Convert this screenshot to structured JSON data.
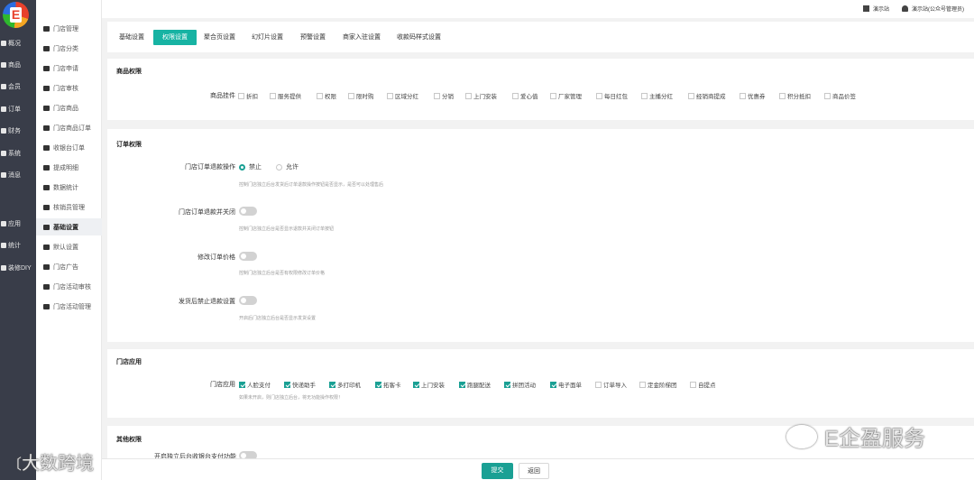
{
  "rail": {
    "logo_letter": "E",
    "items": [
      "概况",
      "商品",
      "会员",
      "订单",
      "财务",
      "系统",
      "消息",
      "应用",
      "统计",
      "装修DIY"
    ]
  },
  "submenu": {
    "items": [
      "门店管理",
      "门店分类",
      "门店申请",
      "门店审核",
      "门店商品",
      "门店商品订单",
      "收银台订单",
      "提成明细",
      "数据统计",
      "核销员管理",
      "基础设置",
      "默认设置",
      "门店广告",
      "门店活动审核",
      "门店活动管理"
    ]
  },
  "topbar": {
    "site": "演示站",
    "user": "演示站(公众号管理员)"
  },
  "tabs": [
    "基础设置",
    "权限设置",
    "聚合页设置",
    "幻灯片设置",
    "预警设置",
    "商家入驻设置",
    "收款码样式设置"
  ],
  "goods_perm": {
    "title": "商品权限",
    "label": "商品挂件",
    "options": [
      "折扣",
      "服务提供",
      "权限",
      "限时购",
      "区域分红",
      "分销",
      "上门安装",
      "爱心值",
      "厂家管理",
      "每日红包",
      "主播分红",
      "经销商提成",
      "优惠券",
      "积分抵扣",
      "商品价签"
    ]
  },
  "order_perm": {
    "title": "订单权限",
    "refund_label": "门店订单退款操作",
    "radio_forbid": "禁止",
    "radio_allow": "允许",
    "refund_hint": "控制门店独立后台发货后订单退款操作按钮是否显示，是否可以处理售后",
    "close_label": "门店订单退款并关闭",
    "close_hint": "控制门店独立后台是否显示退款并关闭订单按钮",
    "price_label": "修改订单价格",
    "price_hint": "控制门店独立后台是否有权限修改订单价格",
    "ship_label": "发货后禁止退款设置",
    "ship_hint": "开启后门店独立后台是否显示发货设置"
  },
  "store_apps": {
    "title": "门店应用",
    "label": "门店应用",
    "options": [
      {
        "label": "人脸支付",
        "on": true
      },
      {
        "label": "快递助手",
        "on": true
      },
      {
        "label": "多打印机",
        "on": true
      },
      {
        "label": "拓客卡",
        "on": true
      },
      {
        "label": "上门安装",
        "on": true
      },
      {
        "label": "跑腿配送",
        "on": true
      },
      {
        "label": "拼团活动",
        "on": true
      },
      {
        "label": "电子面单",
        "on": true
      },
      {
        "label": "订单导入",
        "on": false
      },
      {
        "label": "定金阶梯团",
        "on": false
      },
      {
        "label": "自提点",
        "on": false
      }
    ],
    "hint": "如果未开启，则门店独立后台，将无功能操作权限！"
  },
  "other": {
    "title": "其他权限",
    "row_label": "开启独立后台收银台支付功能"
  },
  "bottom": {
    "submit": "提交",
    "back": "返回"
  },
  "watermarks": {
    "left": "大数跨境",
    "right": "E企盈服务"
  }
}
